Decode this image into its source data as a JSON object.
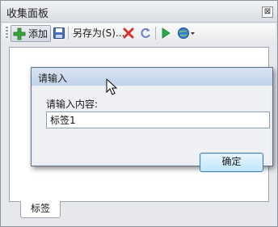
{
  "panel": {
    "title": "收集面板",
    "close_glyph": "⊠"
  },
  "toolbar": {
    "add_label": "添加",
    "save_as_label": "另存为(S)...",
    "icons": [
      "add-icon",
      "save-icon",
      "delete-icon",
      "refresh-icon",
      "play-icon",
      "globe-icon",
      "dropdown-arrow-icon"
    ],
    "colors": {
      "add": "#3aa43a",
      "delete": "#d9302a",
      "play": "#2ea84a",
      "globe": "#3b7fd1"
    }
  },
  "tabs": [
    {
      "label": "标签"
    }
  ],
  "dialog": {
    "title": "请输入",
    "prompt": "请输入内容:",
    "input_value": "标签1",
    "ok_label": "确定"
  }
}
